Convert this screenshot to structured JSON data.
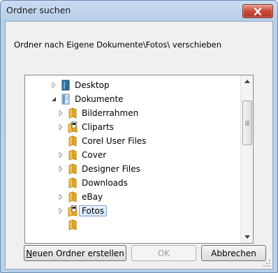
{
  "window": {
    "title": "Ordner suchen"
  },
  "message": "Ordner nach Eigene Dokumente\\Fotos\\ verschieben",
  "tree": {
    "items": [
      {
        "label": "Desktop",
        "icon": "desktop-icon",
        "expander": "collapsed"
      },
      {
        "label": "Dokumente",
        "icon": "documents-library-icon",
        "expander": "expanded"
      },
      {
        "label": "Bilderrahmen",
        "icon": "folder-icon",
        "expander": "collapsed"
      },
      {
        "label": "Cliparts",
        "icon": "folder-with-document-icon",
        "expander": "collapsed"
      },
      {
        "label": "Corel User Files",
        "icon": "folder-icon",
        "expander": "none"
      },
      {
        "label": "Cover",
        "icon": "folder-icon",
        "expander": "collapsed"
      },
      {
        "label": "Designer Files",
        "icon": "folder-icon",
        "expander": "collapsed"
      },
      {
        "label": "Downloads",
        "icon": "folder-icon",
        "expander": "none"
      },
      {
        "label": "eBay",
        "icon": "folder-icon",
        "expander": "collapsed"
      },
      {
        "label": "Fotos",
        "icon": "folder-with-document-icon",
        "expander": "collapsed",
        "selected": true
      }
    ]
  },
  "buttons": {
    "new_folder": "Neuen Ordner erstellen",
    "ok": "OK",
    "cancel": "Abbrechen"
  },
  "colors": {
    "close": "#c8493a",
    "folder": "#e8b23a",
    "selection": "#d4e6fb"
  }
}
